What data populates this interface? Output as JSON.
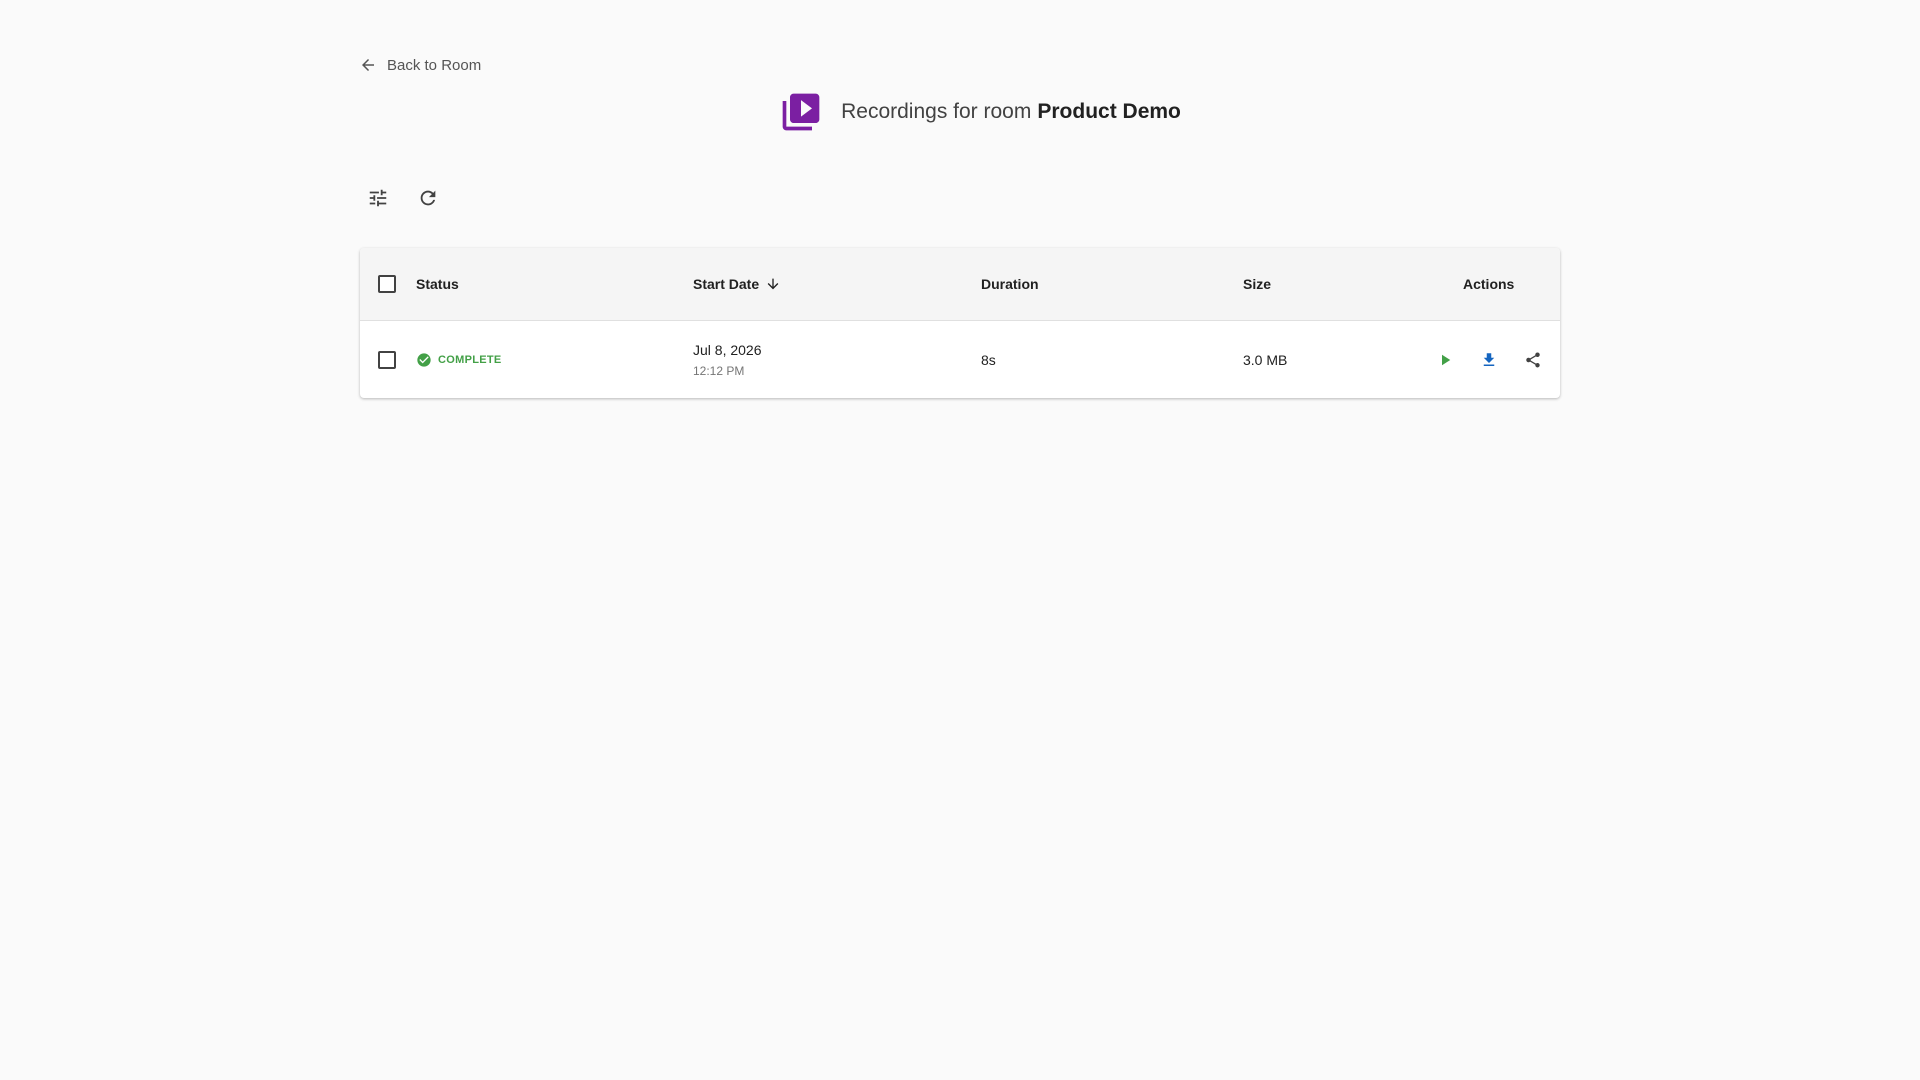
{
  "nav": {
    "back_label": "Back to Room",
    "back_icon": "arrow-left-icon"
  },
  "header": {
    "icon": "video-library-icon",
    "icon_color": "#7b1fa2",
    "title_prefix": "Recordings for room",
    "room_name": "Product Demo"
  },
  "toolbar": {
    "filter_icon": "tune-icon",
    "refresh_icon": "refresh-icon"
  },
  "table": {
    "columns": {
      "status": "Status",
      "start_date": "Start Date",
      "duration": "Duration",
      "size": "Size",
      "actions": "Actions"
    },
    "sort": {
      "column": "Start Date",
      "direction": "descending",
      "icon": "arrow-down-icon"
    },
    "rows": [
      {
        "status": "COMPLETE",
        "status_icon": "check-circle-icon",
        "status_color": "#43a047",
        "date": "Jul 8, 2026",
        "time": "12:12 PM",
        "duration": "8s",
        "size": "3.0 MB",
        "actions": [
          {
            "name": "play-icon",
            "color": "#43a047"
          },
          {
            "name": "download-icon",
            "color": "#1565c0"
          },
          {
            "name": "share-icon",
            "color": "#424242"
          }
        ]
      }
    ]
  }
}
